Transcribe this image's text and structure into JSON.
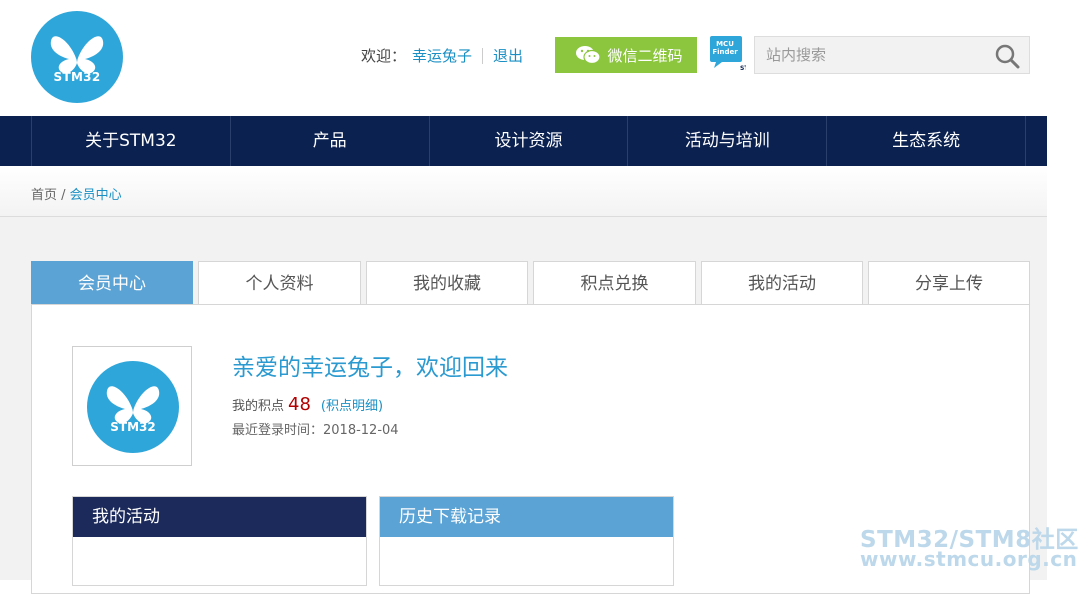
{
  "header": {
    "logo_text": "STM32",
    "welcome_label": "欢迎：",
    "username": "幸运兔子",
    "logout": "退出",
    "wechat_button": "微信二维码",
    "mcu_badge_line1": "MCU",
    "mcu_badge_line2": "Finder",
    "search_placeholder": "站内搜索"
  },
  "nav": {
    "items": [
      "关于STM32",
      "产品",
      "设计资源",
      "活动与培训",
      "生态系统"
    ]
  },
  "breadcrumb": {
    "home": "首页",
    "separator": " / ",
    "current": "会员中心"
  },
  "tabs": [
    "会员中心",
    "个人资料",
    "我的收藏",
    "积点兑换",
    "我的活动",
    "分享上传"
  ],
  "profile": {
    "avatar_text": "STM32",
    "greeting": "亲爱的幸运兔子，欢迎回来",
    "points_label": "我的积点",
    "points_value": "48",
    "points_detail_open": "(",
    "points_detail": "积点明细",
    "points_detail_close": ")",
    "last_login_label": "最近登录时间：",
    "last_login": "2018-12-04"
  },
  "boxes": {
    "activities_title": "我的活动",
    "downloads_title": "历史下载记录"
  },
  "watermark": {
    "line1": "STM32/STM8社区",
    "line2": "www.stmcu.org.cn"
  },
  "colors": {
    "nav_bg": "#0b2150",
    "accent_blue": "#5ba3d4",
    "link_blue": "#1a8fc4",
    "wechat_green": "#8cc63f",
    "points_red": "#b20000"
  }
}
